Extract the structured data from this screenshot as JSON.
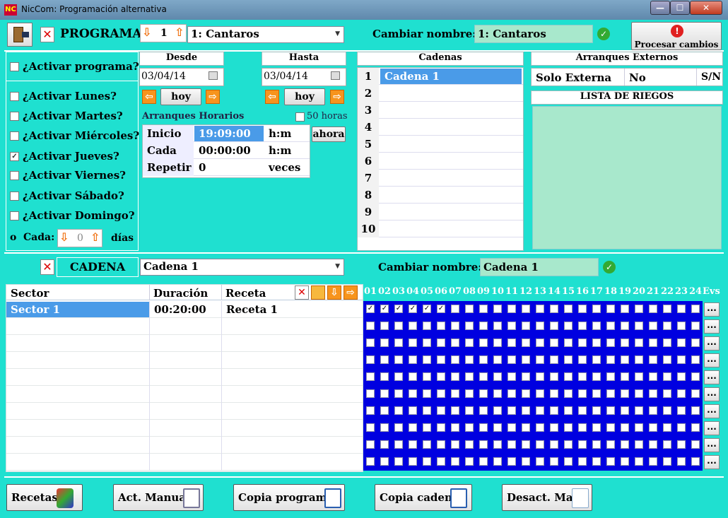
{
  "window": {
    "title": "NicCom: Programación alternativa",
    "min": "—",
    "max": "☐",
    "close": "✕",
    "app_icon": "NC"
  },
  "programa": {
    "close_icon": "✕",
    "label": "PROGRAMA",
    "number": "1",
    "selected": "1: Cantaros",
    "rename_label": "Cambiar nombre:",
    "rename_value": "1: Cantaros",
    "process_label": "Procesar cambios"
  },
  "activar": {
    "program": "¿Activar programa?",
    "days": [
      {
        "label": "¿Activar Lunes?",
        "checked": false
      },
      {
        "label": "¿Activar Martes?",
        "checked": false
      },
      {
        "label": "¿Activar Miércoles?",
        "checked": false
      },
      {
        "label": "¿Activar Jueves?",
        "checked": true
      },
      {
        "label": "¿Activar Viernes?",
        "checked": false
      },
      {
        "label": "¿Activar Sábado?",
        "checked": false
      },
      {
        "label": "¿Activar Domingo?",
        "checked": false
      }
    ],
    "cada_prefix": "o",
    "cada_label": "Cada:",
    "cada_value": "0",
    "cada_unit": "días"
  },
  "desde": {
    "header": "Desde",
    "date": "03/04/14",
    "hoy": "hoy"
  },
  "hasta": {
    "header": "Hasta",
    "date": "03/04/14",
    "hoy": "hoy"
  },
  "arranques": {
    "header": "Arranques Horarios",
    "fifty": "50 horas",
    "ahora": "ahora",
    "rows": [
      {
        "label": "Inicio",
        "value": "19:09:00",
        "unit": "h:m"
      },
      {
        "label": "Cada",
        "value": "00:00:00",
        "unit": "h:m"
      },
      {
        "label": "Repetir",
        "value": "0",
        "unit": "veces"
      }
    ]
  },
  "cadenas": {
    "header": "Cadenas",
    "rows": [
      {
        "n": "1",
        "name": "Cadena 1"
      },
      {
        "n": "2",
        "name": ""
      },
      {
        "n": "3",
        "name": ""
      },
      {
        "n": "4",
        "name": ""
      },
      {
        "n": "5",
        "name": ""
      },
      {
        "n": "6",
        "name": ""
      },
      {
        "n": "7",
        "name": ""
      },
      {
        "n": "8",
        "name": ""
      },
      {
        "n": "9",
        "name": ""
      },
      {
        "n": "10",
        "name": ""
      }
    ]
  },
  "externos": {
    "header": "Arranques Externos",
    "col1": "Solo Externa",
    "col2": "No",
    "col3": "S/N",
    "lista": "LISTA DE RIEGOS"
  },
  "cadena": {
    "label": "CADENA",
    "selected": "Cadena 1",
    "rename_label": "Cambiar nombre:",
    "rename_value": "Cadena 1"
  },
  "sectors": {
    "headers": [
      "Sector",
      "Duración",
      "Receta"
    ],
    "rows": [
      {
        "sector": "Sector 1",
        "duracion": "00:20:00",
        "receta": "Receta 1"
      }
    ]
  },
  "hours": {
    "labels": [
      "01",
      "02",
      "03",
      "04",
      "05",
      "06",
      "07",
      "08",
      "09",
      "10",
      "11",
      "12",
      "13",
      "14",
      "15",
      "16",
      "17",
      "18",
      "19",
      "20",
      "21",
      "22",
      "23",
      "24",
      "Evs"
    ],
    "row1_checked": 6
  },
  "bottom": {
    "recetas": "Recetas",
    "act_manual": "Act. Manual",
    "copia_programa": "Copia programa",
    "copia_cadena": "Copia cadena",
    "desact_man": "Desact. Man."
  },
  "colors": {
    "bg": "#1fe0d0",
    "mint": "#a8e8cc",
    "blue": "#0000e0",
    "select": "#4a9be8"
  }
}
